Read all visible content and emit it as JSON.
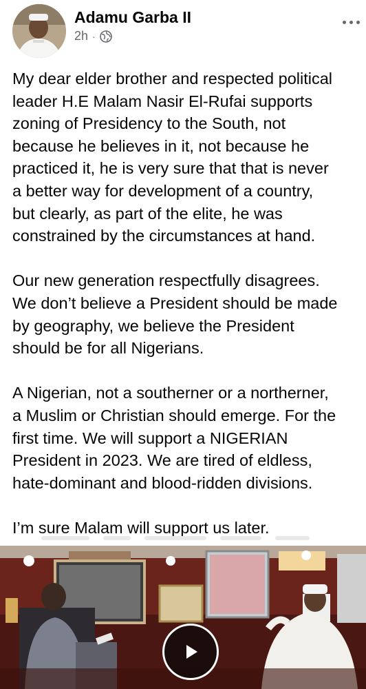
{
  "post": {
    "author": "Adamu Garba II",
    "time": "2h",
    "separator": "·",
    "paragraphs": [
      "My dear elder brother and respected political\nleader H.E Malam Nasir El-Rufai supports\nzoning of Presidency to the South, not\nbecause he believes in it, not because he\npracticed it, he is very sure that that is never\na better way for development of a country,\nbut clearly, as part of the elite, he was\nconstrained by the circumstances at hand.",
      "Our new generation respectfully disagrees.\nWe don’t believe a President should be made\nby geography, we believe the President\nshould be for all Nigerians.",
      "A Nigerian, not a southerner or a northerner,\na Muslim or Christian should emerge. For the\nfirst time. We will support a NIGERIAN\nPresident in 2023. We are tired of eldless,\nhate-dominant and blood-ridden divisions.",
      "I’m sure Malam will support us later."
    ]
  },
  "icons": {
    "privacy": "globe-icon",
    "menu": "more-options-icon",
    "video_control": "play-icon"
  },
  "colors": {
    "text_primary": "#050505",
    "text_secondary": "#65676b",
    "background": "#ffffff"
  }
}
